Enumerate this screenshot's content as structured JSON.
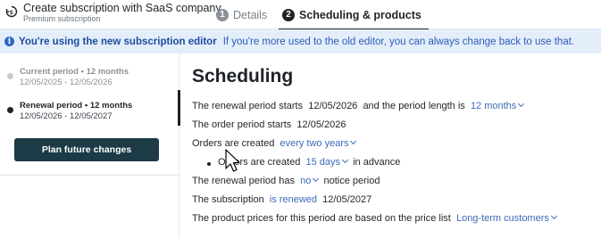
{
  "header": {
    "title": "Create subscription with SaaS company",
    "subtitle": "Premium subscription",
    "tabs": [
      {
        "number": "1",
        "label": "Details",
        "active": false
      },
      {
        "number": "2",
        "label": "Scheduling & products",
        "active": true
      }
    ]
  },
  "banner": {
    "icon": "info-icon",
    "strong": "You're using the new subscription editor",
    "text": "If you're more used to the old editor, you can always change back to use that."
  },
  "sidebar": {
    "periods": [
      {
        "title": "Current period • 12 months",
        "range": "12/05/2025 - 12/05/2026",
        "selected": false
      },
      {
        "title": "Renewal period • 12 months",
        "range": "12/05/2026 - 12/05/2027",
        "selected": true
      }
    ],
    "plan_button": "Plan future changes"
  },
  "main": {
    "heading": "Scheduling",
    "renewal_start": {
      "prefix": "The renewal period starts",
      "date": "12/05/2026",
      "middle": "and the period length is",
      "length": "12 months"
    },
    "order_start": {
      "prefix": "The order period starts",
      "date": "12/05/2026"
    },
    "orders_created": {
      "prefix": "Orders are created",
      "frequency": "every two years"
    },
    "orders_advance": {
      "prefix": "Orders are created",
      "days": "15 days",
      "suffix": "in advance"
    },
    "notice": {
      "prefix": "The renewal period has",
      "value": "no",
      "suffix": "notice period"
    },
    "subscription": {
      "prefix": "The subscription",
      "status": "is renewed",
      "date": "12/05/2027"
    },
    "prices": {
      "prefix": "The product prices for this period are based on the price list",
      "list": "Long-term customers"
    }
  },
  "colors": {
    "accent_link": "#3b6ab8",
    "banner_bg": "#e4eefb",
    "button_bg": "#1d3b47"
  }
}
